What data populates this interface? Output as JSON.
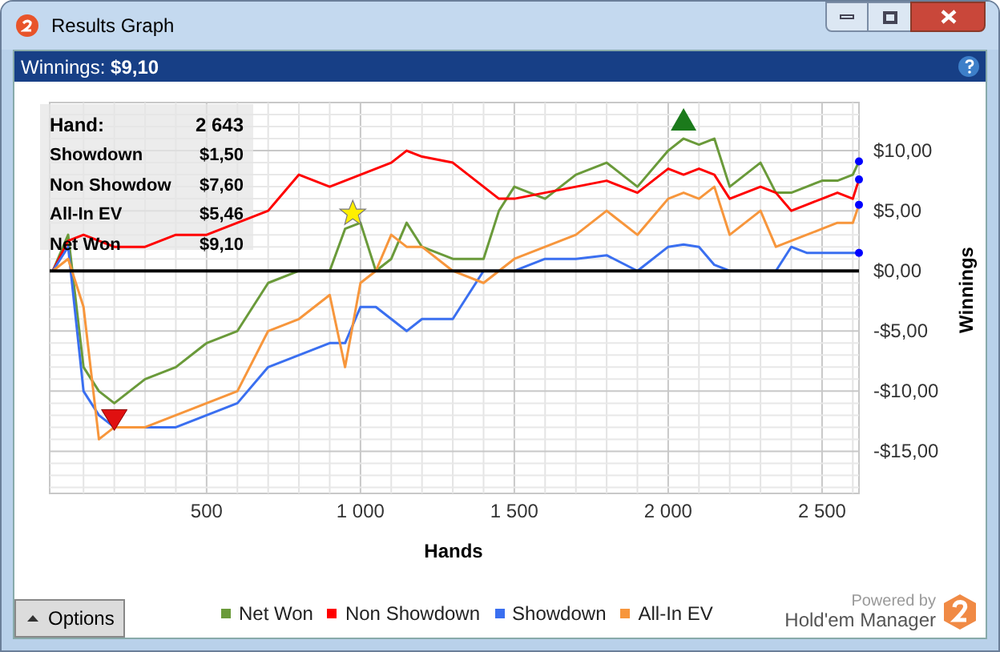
{
  "window": {
    "title": "Results Graph"
  },
  "header": {
    "label": "Winnings:",
    "value": "$9,10"
  },
  "stats": [
    {
      "label": "Hand:",
      "value": "2 643"
    },
    {
      "label": "Showdown",
      "value": "$1,50"
    },
    {
      "label": "Non Showdow",
      "value": "$7,60"
    },
    {
      "label": "All-In EV",
      "value": "$5,46"
    },
    {
      "label": "Net Won",
      "value": "$9,10"
    }
  ],
  "chart_data": {
    "type": "line",
    "grid": true,
    "xlabel": "Hands",
    "ylabel": "Winnings",
    "xlim": [
      -10,
      2620
    ],
    "ylim": [
      -18.5,
      14
    ],
    "xticks": [
      {
        "value": 500,
        "label": "500"
      },
      {
        "value": 1000,
        "label": "1 000"
      },
      {
        "value": 1500,
        "label": "1 500"
      },
      {
        "value": 2000,
        "label": "2 000"
      },
      {
        "value": 2500,
        "label": "2 500"
      }
    ],
    "yticks": [
      {
        "value": 10,
        "label": "$10,00"
      },
      {
        "value": 5,
        "label": "$5,00"
      },
      {
        "value": 0,
        "label": "$0,00"
      },
      {
        "value": -5,
        "label": "-$5,00"
      },
      {
        "value": -10,
        "label": "-$10,00"
      },
      {
        "value": -15,
        "label": "-$15,00"
      }
    ],
    "x": [
      0,
      50,
      100,
      150,
      200,
      300,
      400,
      500,
      600,
      700,
      800,
      900,
      950,
      1000,
      1050,
      1100,
      1150,
      1200,
      1300,
      1400,
      1450,
      1500,
      1600,
      1700,
      1800,
      1900,
      2000,
      2050,
      2100,
      2150,
      2200,
      2250,
      2300,
      2350,
      2400,
      2450,
      2500,
      2550,
      2600,
      2620
    ],
    "series": [
      {
        "name": "Net Won",
        "color": "#6a9a3a",
        "values": [
          0,
          3,
          -8,
          -10,
          -11,
          -9,
          -8,
          -6,
          -5,
          -1,
          0,
          0,
          3.5,
          4,
          0,
          1,
          4,
          2,
          1,
          1,
          5,
          7,
          6,
          8,
          9,
          7,
          10,
          11,
          10.5,
          11,
          7,
          8,
          9,
          6.5,
          6.5,
          7,
          7.5,
          7.5,
          8,
          9.1
        ]
      },
      {
        "name": "Non Showdown",
        "color": "#ff0000",
        "values": [
          0,
          2.5,
          3,
          2.5,
          2,
          2,
          3,
          3,
          4,
          5,
          8,
          7,
          7.5,
          8,
          8.5,
          9,
          10,
          9.5,
          9,
          7,
          6,
          6,
          6.5,
          7,
          7.5,
          6.5,
          8.5,
          8,
          8.5,
          8,
          6,
          6.5,
          7,
          6.5,
          5,
          5.5,
          6,
          6.5,
          6,
          7.6
        ]
      },
      {
        "name": "Showdown",
        "color": "#3a6ff0",
        "values": [
          0,
          2,
          -10,
          -12,
          -13,
          -13,
          -13,
          -12,
          -11,
          -8,
          -7,
          -6,
          -6,
          -3,
          -3,
          -4,
          -5,
          -4,
          -4,
          0,
          0,
          0,
          1,
          1,
          1.3,
          0,
          2,
          2.2,
          2,
          0.5,
          0,
          0,
          0,
          0,
          2,
          1.5,
          1.5,
          1.5,
          1.5,
          1.5
        ]
      },
      {
        "name": "All-In EV",
        "color": "#f7963c",
        "values": [
          0,
          1,
          -3,
          -14,
          -13,
          -13,
          -12,
          -11,
          -10,
          -5,
          -4,
          -2,
          -8,
          -1,
          0,
          3,
          2,
          2,
          0,
          -1,
          0,
          1,
          2,
          3,
          5,
          3,
          6,
          6.5,
          6,
          7,
          3,
          4,
          5,
          2,
          2.5,
          3,
          3.5,
          4,
          4,
          5.5
        ]
      }
    ]
  },
  "options_button": "Options",
  "powered": {
    "label": "Powered by",
    "brand": "Hold'em Manager"
  }
}
